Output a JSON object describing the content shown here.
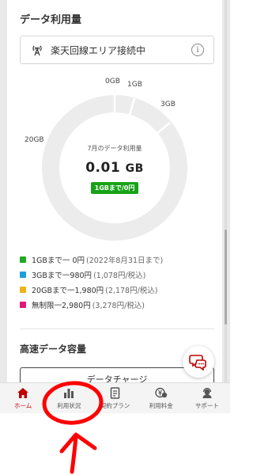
{
  "data_usage": {
    "title": "データ利用量",
    "status_label": "楽天回線エリア接続中",
    "info_glyph": "i",
    "gauge": {
      "ticks": [
        "0GB",
        "1GB",
        "3GB",
        "20GB"
      ],
      "caption": "7月のデータ利用量",
      "used_value": "0.01",
      "used_unit": "GB",
      "badge": "1GBまで/0円"
    },
    "legend": [
      {
        "main": "1GBまで一 0円",
        "sub": "(2022年8月31日まで)",
        "color": "#22a822"
      },
      {
        "main": "3GBまで一980円",
        "sub": "(1,078円/税込)",
        "color": "#1aa0dd"
      },
      {
        "main": "20GBまで一1,980円",
        "sub": "(2,178円/税込)",
        "color": "#f0b21a"
      },
      {
        "main": "無制限一2,980円",
        "sub": "(3,278円/税込)",
        "color": "#e0167a"
      }
    ]
  },
  "high_speed": {
    "title": "高速データ容量",
    "charge_button": "データチャージ"
  },
  "tabbar": {
    "items": [
      {
        "label": "ホーム",
        "icon": "home-icon",
        "active": true
      },
      {
        "label": "利用状況",
        "icon": "bar-chart-icon",
        "active": false
      },
      {
        "label": "契約プラン",
        "icon": "contract-icon",
        "active": false
      },
      {
        "label": "利用料金",
        "icon": "yen-icon",
        "active": false
      },
      {
        "label": "サポート",
        "icon": "support-icon",
        "active": false
      }
    ]
  },
  "colors": {
    "accent": "#bf0000",
    "gauge_track": "#ececec",
    "annotation_red": "#ff0000"
  }
}
